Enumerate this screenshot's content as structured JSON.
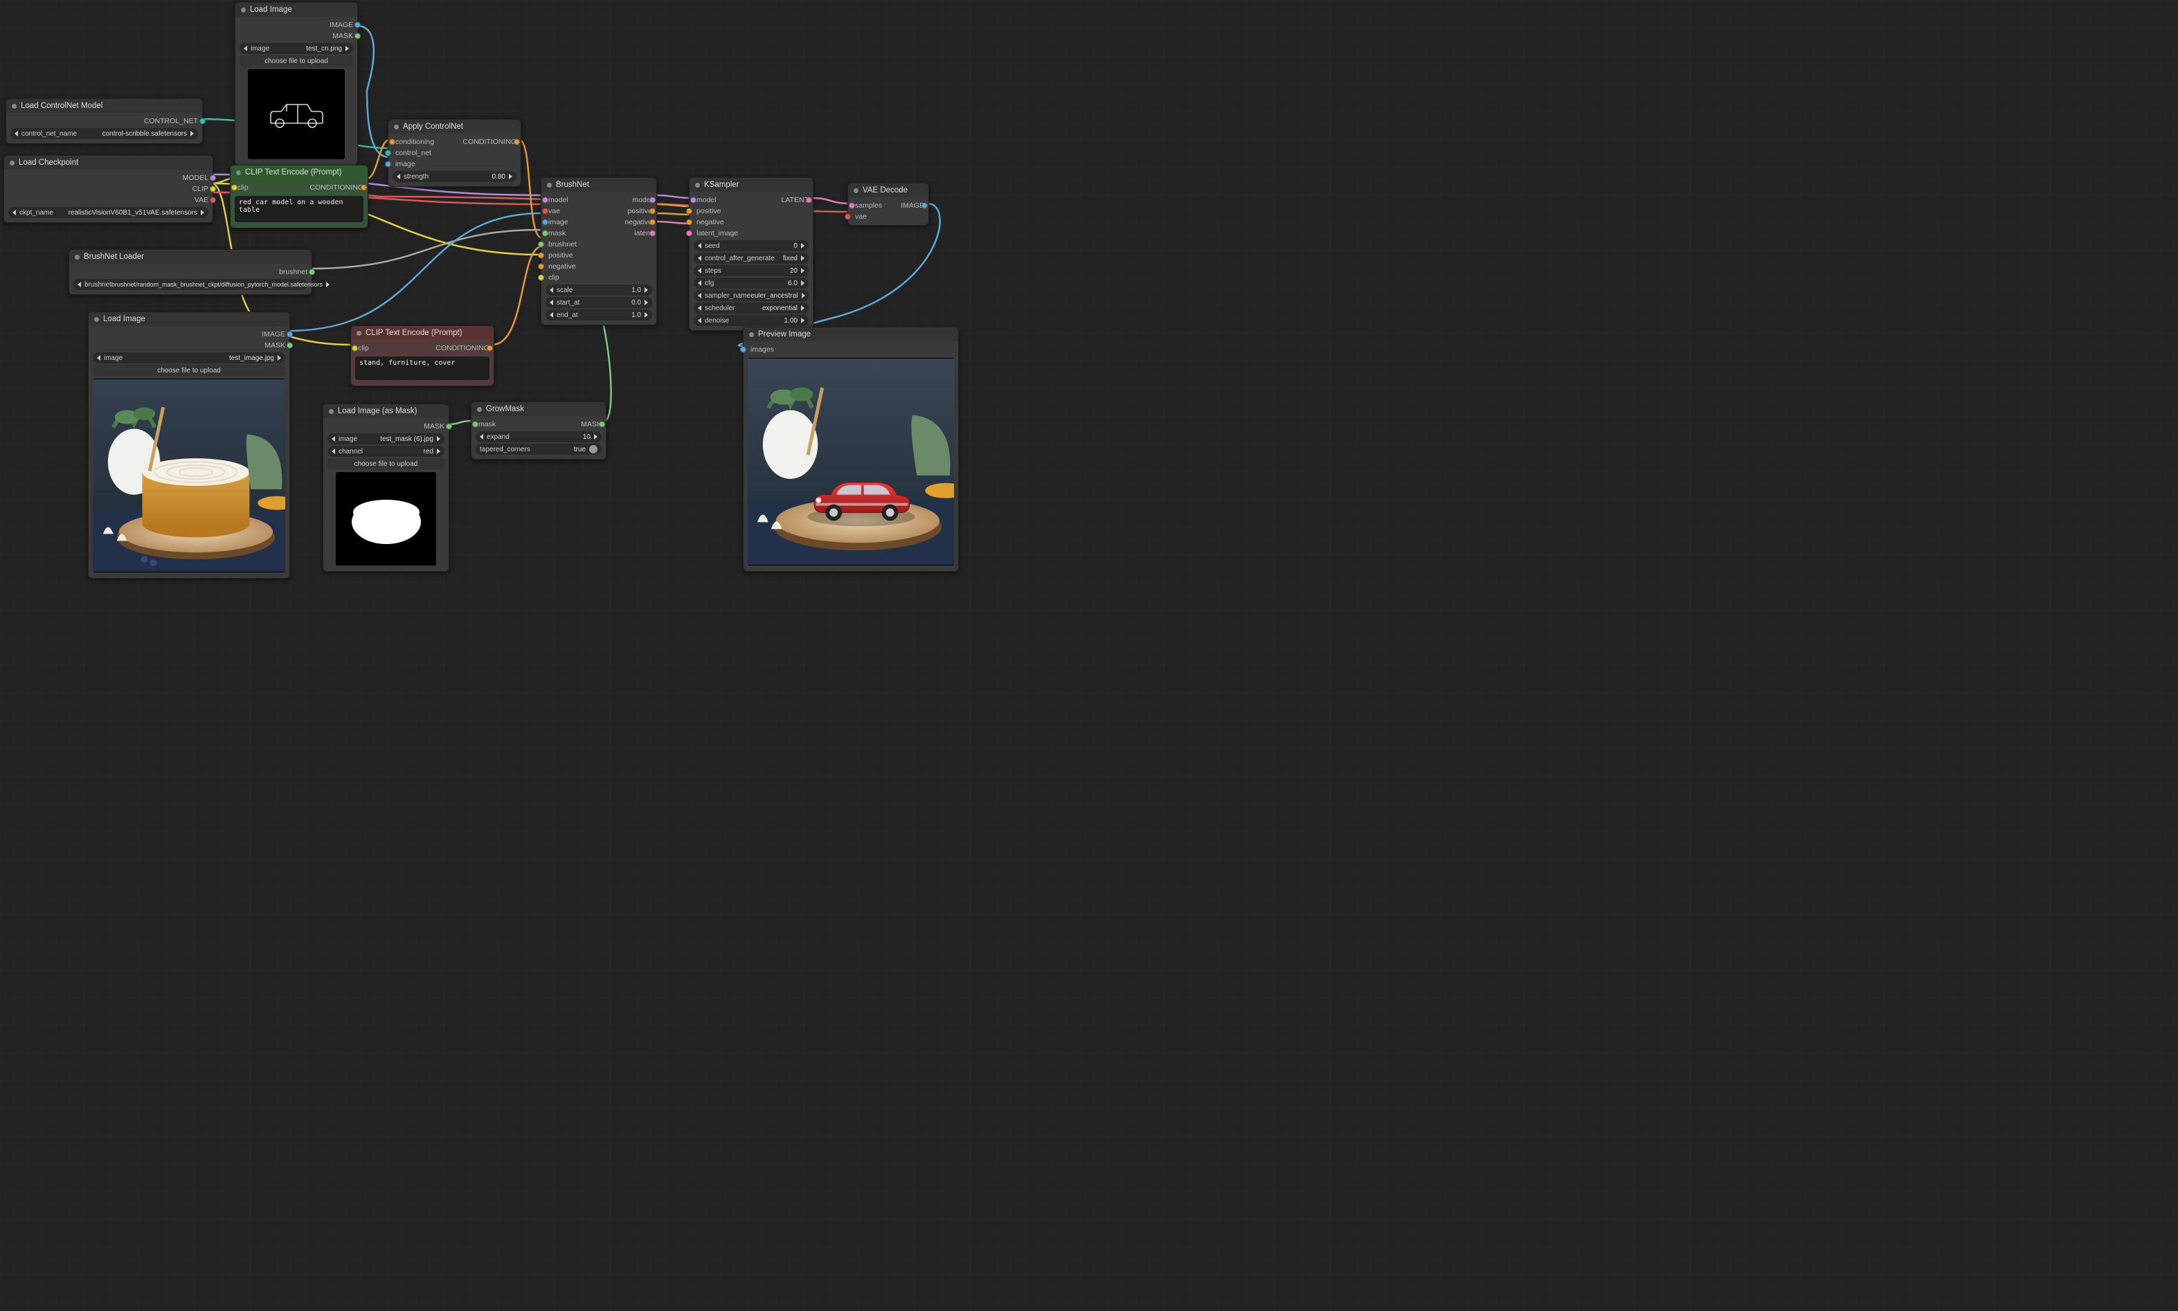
{
  "nodes": {
    "load_image_top": {
      "title": "Load Image",
      "out_image": "IMAGE",
      "out_mask": "MASK",
      "widget_image_label": "image",
      "widget_image_value": "test_cn.png",
      "button_upload": "choose file to upload"
    },
    "load_controlnet": {
      "title": "Load ControlNet Model",
      "out": "CONTROL_NET",
      "widget_label": "control_net_name",
      "widget_value": "control-scribble.safetensors"
    },
    "load_checkpoint": {
      "title": "Load Checkpoint",
      "out_model": "MODEL",
      "out_clip": "CLIP",
      "out_vae": "VAE",
      "widget_label": "ckpt_name",
      "widget_value": "realisticVisionV60B1_v51VAE.safetensors"
    },
    "clip_pos": {
      "title": "CLIP Text Encode (Prompt)",
      "in_clip": "clip",
      "out": "CONDITIONING",
      "text": "red car model on a wooden table"
    },
    "apply_controlnet": {
      "title": "Apply ControlNet",
      "in_conditioning": "conditioning",
      "in_control_net": "control_net",
      "in_image": "image",
      "out": "CONDITIONING",
      "strength_label": "strength",
      "strength_value": "0.80"
    },
    "brushnet_loader": {
      "title": "BrushNet Loader",
      "out": "brushnet",
      "widget_label": "brushnet",
      "widget_value": "brushnet/random_mask_brushnet_ckpt/diffusion_pytorch_model.safetensors"
    },
    "load_image_cake": {
      "title": "Load Image",
      "out_image": "IMAGE",
      "out_mask": "MASK",
      "widget_image_label": "image",
      "widget_image_value": "test_image.jpg",
      "button_upload": "choose file to upload"
    },
    "clip_neg": {
      "title": "CLIP Text Encode (Prompt)",
      "in_clip": "clip",
      "out": "CONDITIONING",
      "text": "stand, furniture, cover"
    },
    "load_image_mask": {
      "title": "Load Image (as Mask)",
      "out": "MASK",
      "widget_image_label": "image",
      "widget_image_value": "test_mask (6).jpg",
      "widget_channel_label": "channel",
      "widget_channel_value": "red",
      "button_upload": "choose file to upload"
    },
    "growmask": {
      "title": "GrowMask",
      "in_mask": "mask",
      "out": "MASK",
      "expand_label": "expand",
      "expand_value": "10",
      "tapered_label": "tapered_corners",
      "tapered_value": "true"
    },
    "brushnet": {
      "title": "BrushNet",
      "in_model": "model",
      "in_vae": "vae",
      "in_image": "image",
      "in_mask": "mask",
      "in_brushnet": "brushnet",
      "in_positive": "positive",
      "in_negative": "negative",
      "in_clip": "clip",
      "out_model": "model",
      "out_positive": "positive",
      "out_negative": "negative",
      "out_latent": "latent",
      "scale_label": "scale",
      "scale_value": "1.0",
      "start_label": "start_at",
      "start_value": "0.0",
      "end_label": "end_at",
      "end_value": "1.0"
    },
    "ksampler": {
      "title": "KSampler",
      "in_model": "model",
      "in_positive": "positive",
      "in_negative": "negative",
      "in_latent": "latent_image",
      "out": "LATENT",
      "seed_label": "seed",
      "seed_value": "0",
      "cag_label": "control_after_generate",
      "cag_value": "fixed",
      "steps_label": "steps",
      "steps_value": "20",
      "cfg_label": "cfg",
      "cfg_value": "6.0",
      "sampler_label": "sampler_name",
      "sampler_value": "euler_ancestral",
      "scheduler_label": "scheduler",
      "scheduler_value": "exponential",
      "denoise_label": "denoise",
      "denoise_value": "1.00"
    },
    "vae_decode": {
      "title": "VAE Decode",
      "in_samples": "samples",
      "in_vae": "vae",
      "out": "IMAGE"
    },
    "preview": {
      "title": "Preview Image",
      "in_images": "images"
    }
  }
}
